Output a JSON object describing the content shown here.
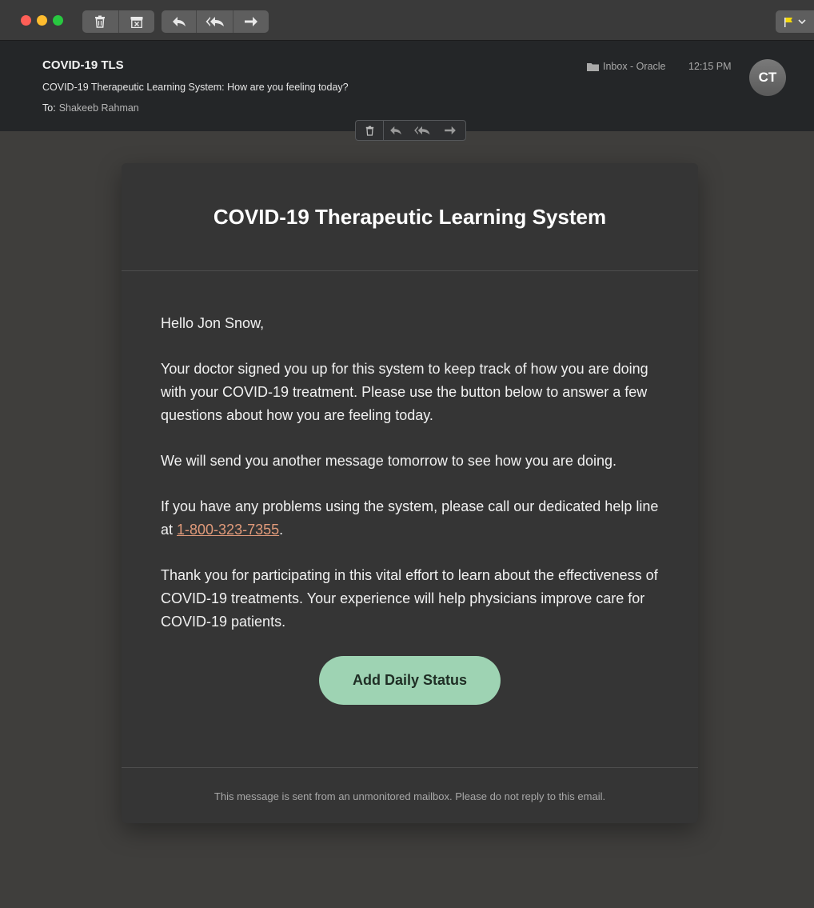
{
  "toolbar": {
    "buttons": [
      {
        "group": 1,
        "icon": "trash-icon"
      },
      {
        "group": 1,
        "icon": "archive-icon"
      },
      {
        "group": 2,
        "icon": "reply-icon"
      },
      {
        "group": 2,
        "icon": "reply-all-icon"
      },
      {
        "group": 2,
        "icon": "forward-icon"
      }
    ],
    "flag_icon": "flag-icon",
    "flag_color": "#f5d90a"
  },
  "header": {
    "sender": "COVID-19 TLS",
    "subject": "COVID-19 Therapeutic Learning System: How are you feeling today?",
    "to_label": "To:",
    "to_name": "Shakeeb Rahman",
    "mailbox": "Inbox - Oracle",
    "time": "12:15 PM",
    "avatar_initials": "CT"
  },
  "email": {
    "title": "COVID-19 Therapeutic Learning System",
    "greeting": "Hello Jon Snow,",
    "paragraph1": "Your doctor signed you up for this system to keep track of how you are doing with your COVID-19 treatment. Please use the button below to answer a few questions about how you are feeling today.",
    "paragraph2": "We will send you another message tomorrow to see how you are doing.",
    "paragraph3_before": "If you have any problems using the system, please call our dedicated help line at ",
    "phone": "1-800-323-7355",
    "paragraph3_after": ".",
    "paragraph4": "Thank you for participating in this vital effort to learn about the effectiveness of COVID-19 treatments. Your experience will help physicians improve care for COVID-19 patients.",
    "button_label": "Add Daily Status",
    "footer": "This message is sent from an unmonitored mailbox. Please do not reply to this email."
  },
  "colors": {
    "button_bg": "#9ed3b3",
    "link": "#e09a7a",
    "card_bg": "#353535",
    "header_bg": "#242628"
  }
}
